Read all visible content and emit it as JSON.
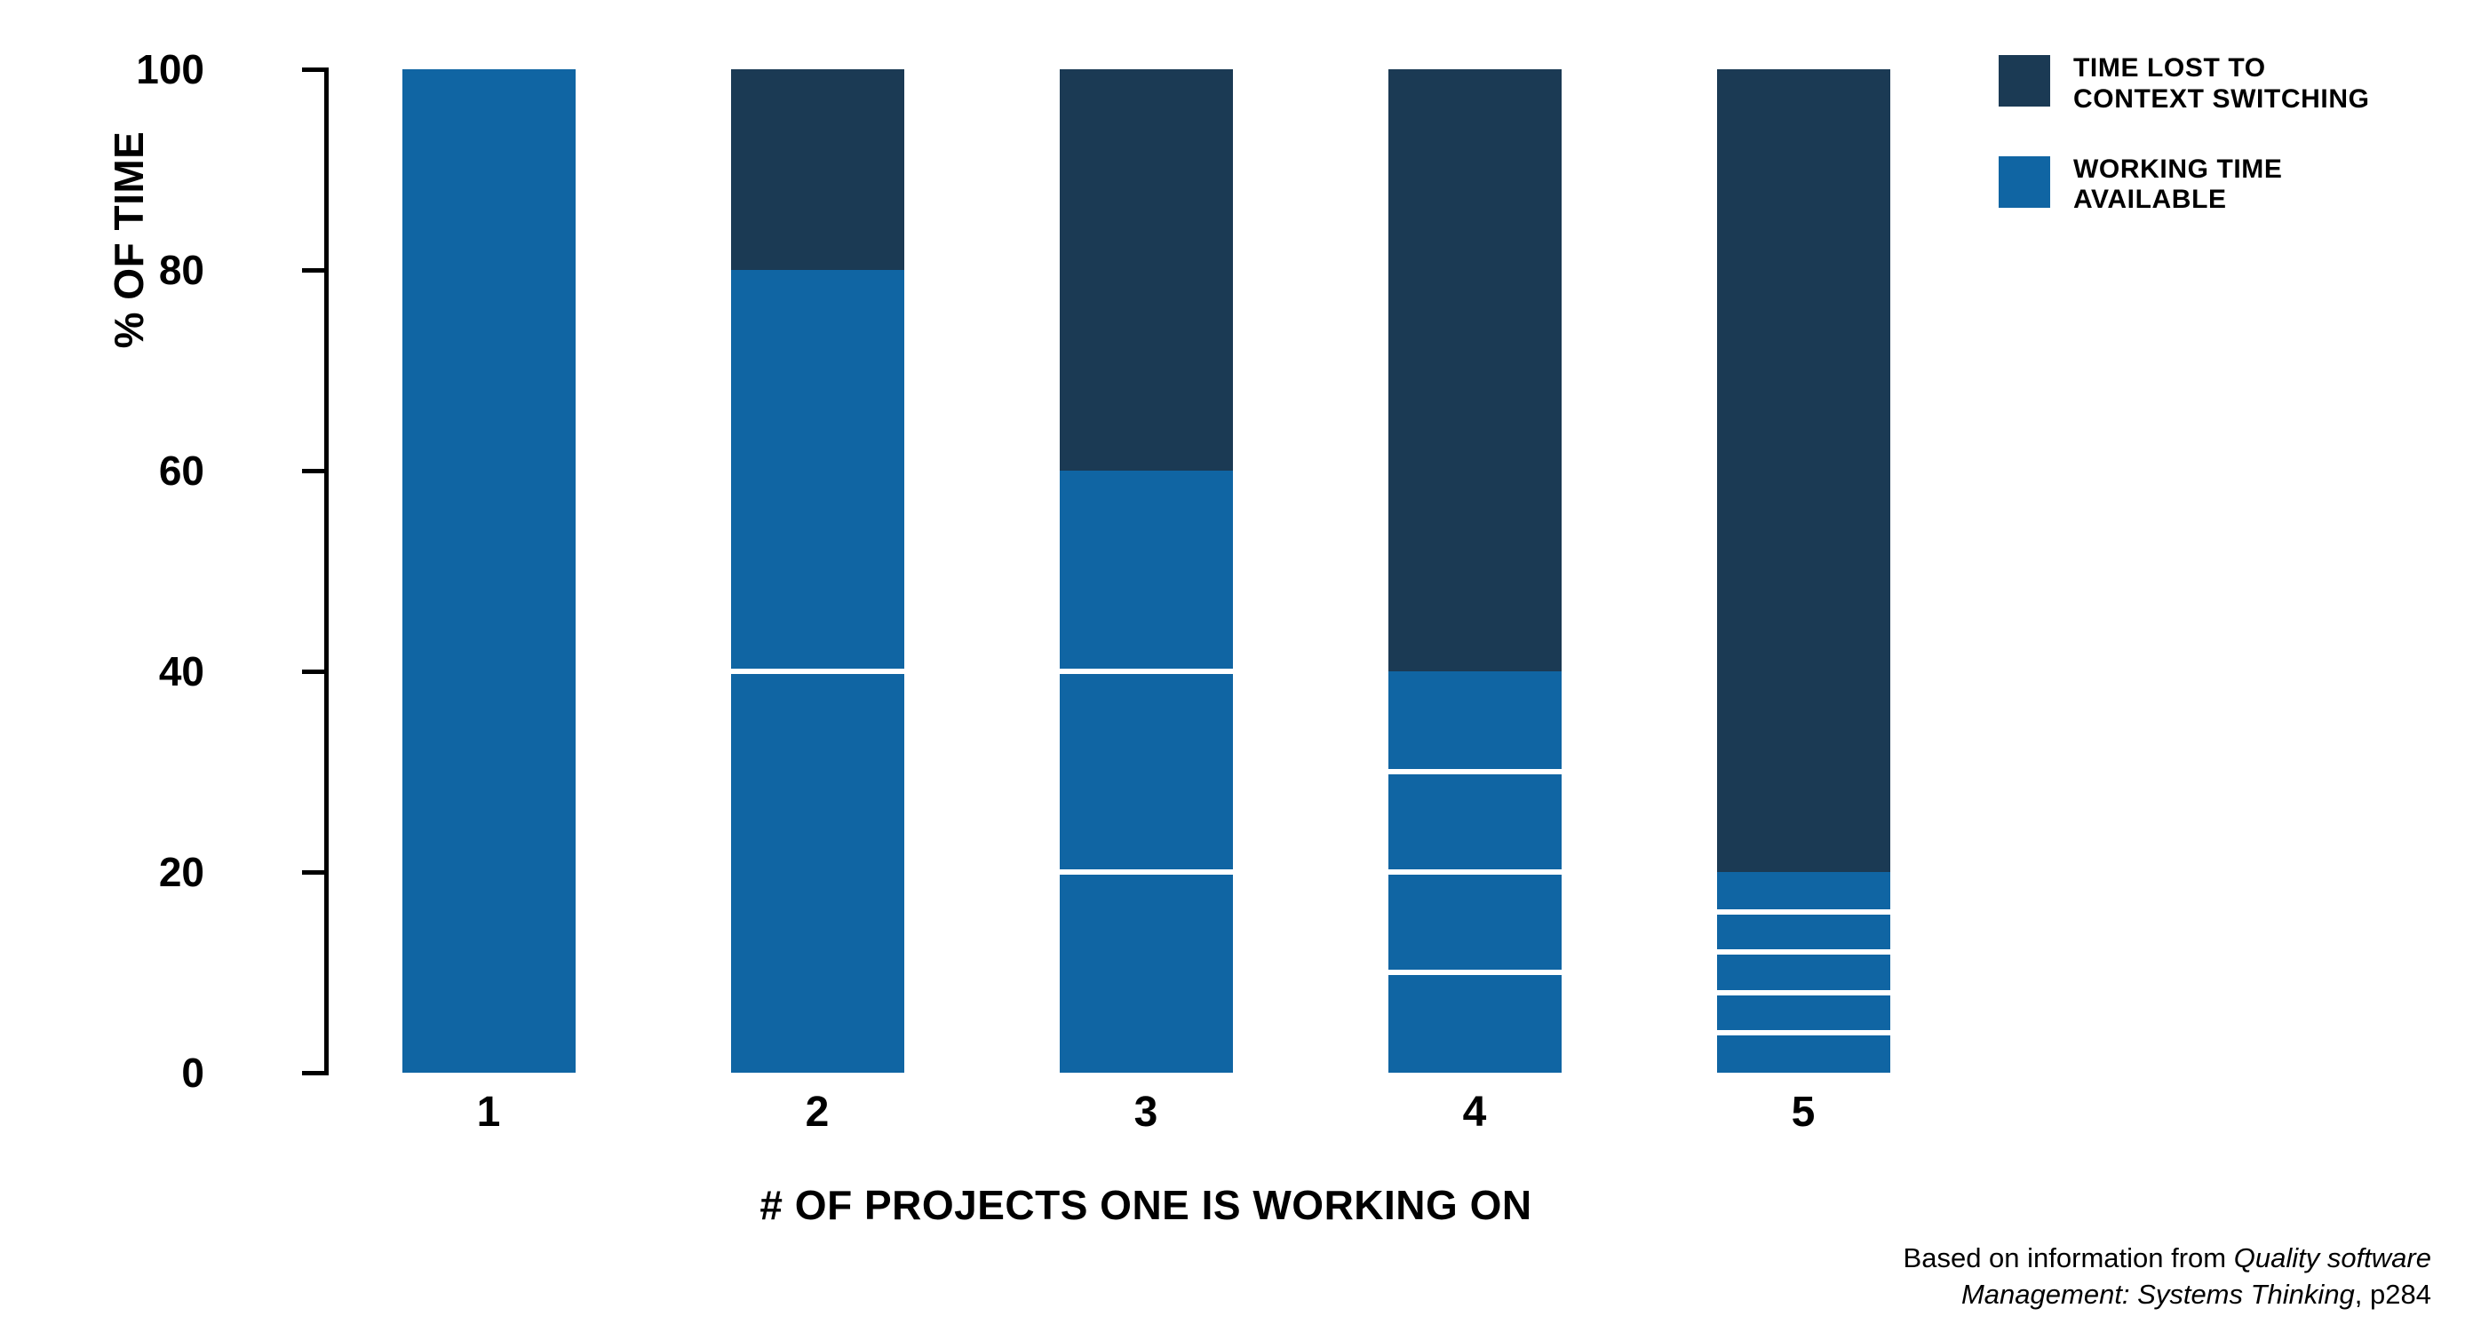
{
  "chart_data": {
    "type": "bar",
    "subtype": "stacked-100-percent",
    "title": "",
    "xlabel": "# OF PROJECTS ONE IS WORKING ON",
    "ylabel": "% OF TIME",
    "categories": [
      "1",
      "2",
      "3",
      "4",
      "5"
    ],
    "ylim": [
      0,
      100
    ],
    "y_ticks": [
      0,
      20,
      40,
      60,
      80,
      100
    ],
    "y_tick_labels": [
      "0",
      "20",
      "40",
      "60",
      "80",
      "100"
    ],
    "grid": false,
    "legend_position": "right",
    "series": [
      {
        "name": "WORKING TIME\nAVAILABLE",
        "color": "#1065A3",
        "values": [
          100,
          80,
          60,
          40,
          20
        ]
      },
      {
        "name": "TIME LOST TO\nCONTEXT SWITCHING",
        "color": "#1B3A54",
        "values": [
          0,
          20,
          40,
          60,
          80
        ]
      }
    ],
    "working_time_split": [
      {
        "category": "1",
        "segments": [
          100
        ]
      },
      {
        "category": "2",
        "segments": [
          40,
          40
        ]
      },
      {
        "category": "3",
        "segments": [
          20,
          20,
          20
        ]
      },
      {
        "category": "4",
        "segments": [
          10,
          10,
          10,
          10
        ]
      },
      {
        "category": "5",
        "segments": [
          4,
          4,
          4,
          4,
          4
        ]
      }
    ],
    "annotations": []
  },
  "axes": {
    "y_title": "% OF TIME",
    "x_title": "# OF PROJECTS ONE IS WORKING ON",
    "y_tick_labels": [
      "100",
      "80",
      "60",
      "40",
      "20",
      "0"
    ],
    "x_tick_labels": [
      "1",
      "2",
      "3",
      "4",
      "5"
    ]
  },
  "legend": {
    "items": [
      {
        "label": "TIME LOST TO\nCONTEXT SWITCHING",
        "color": "#1B3A54"
      },
      {
        "label": "WORKING TIME\nAVAILABLE",
        "color": "#1065A3"
      }
    ]
  },
  "attribution": {
    "line1_prefix": "Based on information from ",
    "line1_italic": "Quality software",
    "line2_italic": "Management: Systems Thinking",
    "line2_suffix": ", p284"
  },
  "colors": {
    "context_switching": "#1B3A54",
    "working_time": "#1065A3",
    "axis": "#000000",
    "divider": "#FFFFFF",
    "background": "#FFFFFF"
  }
}
